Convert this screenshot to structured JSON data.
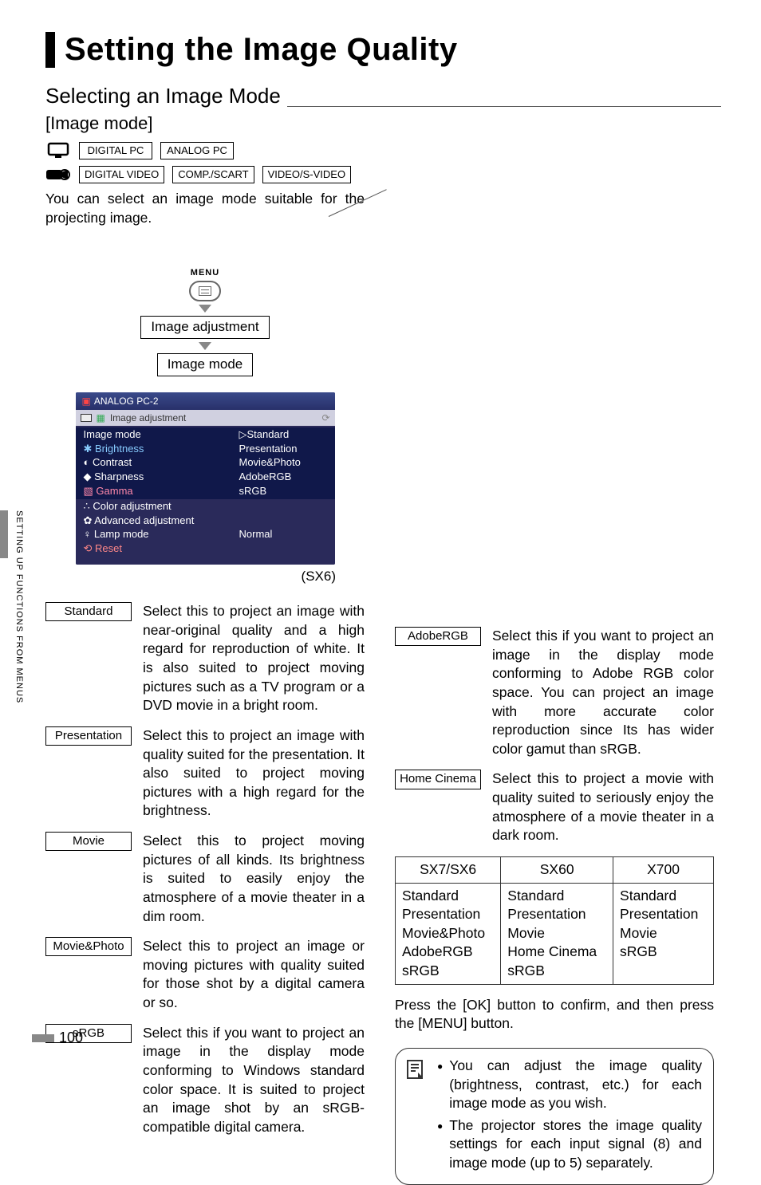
{
  "title": "Setting the Image Quality",
  "subsection_title": "Selecting an Image Mode",
  "subsection_label": "[Image mode]",
  "tags_pc": [
    "DIGITAL PC",
    "ANALOG PC"
  ],
  "tags_video": [
    "DIGITAL VIDEO",
    "COMP./SCART",
    "VIDEO/S-VIDEO"
  ],
  "intro": "You can select an image mode suitable for the projecting image.",
  "flow": {
    "menu_label": "MENU",
    "step1": "Image adjustment",
    "step2": "Image mode"
  },
  "menu_screenshot": {
    "header": "ANALOG PC-2",
    "tab_label": "Image adjustment",
    "rows_highlight": {
      "key": "Image mode",
      "val": "▷Standard"
    },
    "sub_options": [
      "Presentation",
      "Movie&Photo",
      "AdobeRGB",
      "sRGB"
    ],
    "rows": [
      {
        "key": "Brightness",
        "val": ""
      },
      {
        "key": "Contrast",
        "val": ""
      },
      {
        "key": "Sharpness",
        "val": ""
      },
      {
        "key": "Gamma",
        "val": ""
      },
      {
        "key": "Color adjustment",
        "val": ""
      },
      {
        "key": "Advanced adjustment",
        "val": ""
      },
      {
        "key": "Lamp mode",
        "val": "Normal"
      },
      {
        "key": "Reset",
        "val": ""
      }
    ],
    "caption": "(SX6)"
  },
  "modes_left": [
    {
      "label": "Standard",
      "desc": "Select this to project an image with near-original quality and a high regard for reproduction of white. It is also suited to project moving pictures such as a TV program or a DVD movie in a bright room."
    },
    {
      "label": "Presentation",
      "desc": "Select this to project an image with quality suited for the presentation. It also suited to project moving pictures with a high regard for the brightness."
    },
    {
      "label": "Movie",
      "desc": "Select this to project moving pictures of all kinds. Its brightness is suited to easily enjoy the atmosphere of a movie theater in a dim room."
    },
    {
      "label": "Movie&Photo",
      "desc": "Select this to project an image or moving pictures with quality suited for those shot by a digital camera or so."
    },
    {
      "label": "sRGB",
      "desc": "Select this if you want to project an image in the display mode conforming to Windows standard color space. It is suited to project an image shot by an sRGB-compatible digital camera."
    }
  ],
  "modes_right": [
    {
      "label": "AdobeRGB",
      "desc": "Select this if you want to project an image in the display mode conforming to Adobe RGB color space. You can project an image with more accurate color reproduction since Its has wider color gamut than sRGB."
    },
    {
      "label": "Home Cinema",
      "desc": "Select this to project a movie with quality suited to seriously enjoy the atmosphere of a movie theater in a dark room."
    }
  ],
  "model_table": {
    "headers": [
      "SX7/SX6",
      "SX60",
      "X700"
    ],
    "cols": [
      [
        "Standard",
        "Presentation",
        "Movie&Photo",
        "AdobeRGB",
        "sRGB"
      ],
      [
        "Standard",
        "Presentation",
        "Movie",
        "Home Cinema",
        "sRGB"
      ],
      [
        "Standard",
        "Presentation",
        "Movie",
        "sRGB"
      ]
    ]
  },
  "press_text": "Press the [OK] button to confirm, and then press the [MENU] button.",
  "notes": [
    "You can adjust the image quality (brightness, contrast, etc.) for each image mode as you wish.",
    "The projector stores the image quality settings for each input signal (8) and image mode (up to 5) separately."
  ],
  "side_tab": "SETTING UP FUNCTIONS FROM MENUS",
  "page_number": "100"
}
